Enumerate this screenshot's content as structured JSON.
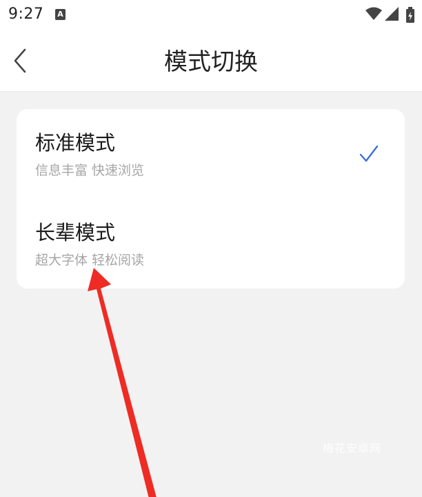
{
  "status_bar": {
    "time": "9:27",
    "notification_icon": "a-letter-icon",
    "icons": [
      "wifi-icon",
      "signal-icon",
      "battery-icon"
    ]
  },
  "header": {
    "back_icon": "chevron-left-icon",
    "title": "模式切换"
  },
  "modes": [
    {
      "title": "标准模式",
      "subtitle": "信息丰富 快速浏览",
      "selected": true,
      "check_icon": "checkmark-icon"
    },
    {
      "title": "长辈模式",
      "subtitle": "超大字体 轻松阅读",
      "selected": false
    }
  ],
  "annotation": {
    "icon": "red-arrow-icon",
    "color": "#ee2c24"
  },
  "watermark": "梅花安卓网",
  "colors": {
    "background": "#f2f2f2",
    "card": "#ffffff",
    "check": "#3a6fd8",
    "subtitle": "#a6a6a6"
  }
}
